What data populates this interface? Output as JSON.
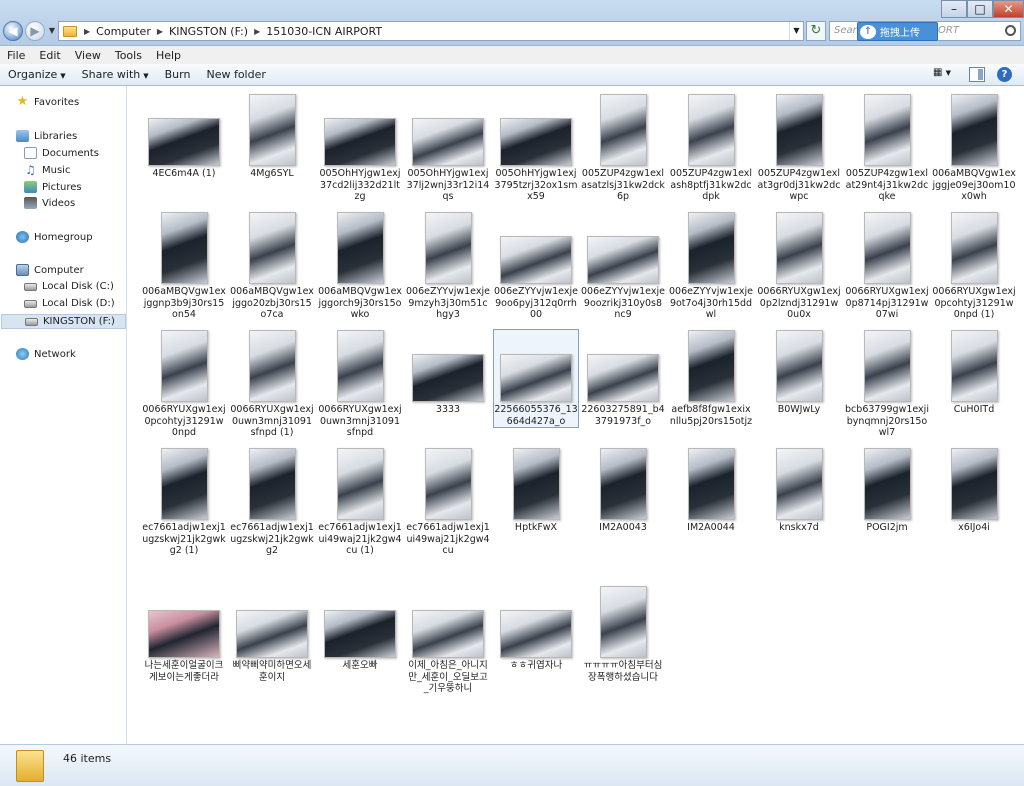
{
  "address": {
    "crumbs": [
      "Computer",
      "KINGSTON (F:)",
      "151030-ICN AIRPORT"
    ],
    "search_placeholder": "Search",
    "search_tail": "ORT"
  },
  "upload_popup": {
    "label": "拖拽上传"
  },
  "menu": [
    "File",
    "Edit",
    "View",
    "Tools",
    "Help"
  ],
  "toolbar": {
    "organize": "Organize",
    "share": "Share with",
    "burn": "Burn",
    "new_folder": "New folder"
  },
  "nav": {
    "favorites": "Favorites",
    "libraries": "Libraries",
    "documents": "Documents",
    "music": "Music",
    "pictures": "Pictures",
    "videos": "Videos",
    "homegroup": "Homegroup",
    "computer": "Computer",
    "local_c": "Local Disk (C:)",
    "local_d": "Local Disk (D:)",
    "kingston": "KINGSTON (F:)",
    "network": "Network"
  },
  "files": [
    {
      "name": "4EC6m4A (1)",
      "shape": "land",
      "tone": "dark"
    },
    {
      "name": "4Mg6SYL",
      "shape": "portrait",
      "tone": "light"
    },
    {
      "name": "005OhHYjgw1exj37cd2lij332d21ltzg",
      "shape": "land",
      "tone": "dark"
    },
    {
      "name": "005OhHYjgw1exj37lj2wnj33r12i14qs",
      "shape": "land",
      "tone": "light"
    },
    {
      "name": "005OhHYjgw1exj3795tzrj32ox1smx59",
      "shape": "land",
      "tone": "dark"
    },
    {
      "name": "005ZUP4zgw1exlasatzlsj31kw2dck6p",
      "shape": "portrait",
      "tone": "light"
    },
    {
      "name": "005ZUP4zgw1exlash8ptfj31kw2dcdpk",
      "shape": "portrait",
      "tone": "light"
    },
    {
      "name": "005ZUP4zgw1exlat3gr0dj31kw2dcwpc",
      "shape": "portrait",
      "tone": "dark"
    },
    {
      "name": "005ZUP4zgw1exlat29nt4j31kw2dcqke",
      "shape": "portrait",
      "tone": "light"
    },
    {
      "name": "006aMBQVgw1exjggje09ej30om10x0wh",
      "shape": "portrait",
      "tone": "dark"
    },
    {
      "name": "006aMBQVgw1exjggnp3b9j30rs15on54",
      "shape": "portrait",
      "tone": "dark"
    },
    {
      "name": "006aMBQVgw1exjggo20zbj30rs15o7ca",
      "shape": "portrait",
      "tone": "light"
    },
    {
      "name": "006aMBQVgw1exjggorch9j30rs15owko",
      "shape": "portrait",
      "tone": "dark"
    },
    {
      "name": "006eZYYvjw1exje9mzyh3j30m51chgy3",
      "shape": "portrait",
      "tone": "light"
    },
    {
      "name": "006eZYYvjw1exje9oo6pyj312q0rrh00",
      "shape": "land",
      "tone": "light"
    },
    {
      "name": "006eZYYvjw1exje9oozrikj310y0s8nc9",
      "shape": "land",
      "tone": "light"
    },
    {
      "name": "006eZYYvjw1exje9ot7o4j30rh15ddwl",
      "shape": "portrait",
      "tone": "dark"
    },
    {
      "name": "0066RYUXgw1exj0p2lzndj31291w0u0x",
      "shape": "portrait",
      "tone": "light"
    },
    {
      "name": "0066RYUXgw1exj0p8714pj31291w07wi",
      "shape": "portrait",
      "tone": "light"
    },
    {
      "name": "0066RYUXgw1exj0pcohtyj31291w0npd (1)",
      "shape": "portrait",
      "tone": "light"
    },
    {
      "name": "0066RYUXgw1exj0pcohtyj31291w0npd",
      "shape": "portrait",
      "tone": "light"
    },
    {
      "name": "0066RYUXgw1exj0uwn3mnj31091sfnpd (1)",
      "shape": "portrait",
      "tone": "light"
    },
    {
      "name": "0066RYUXgw1exj0uwn3mnj31091sfnpd",
      "shape": "portrait",
      "tone": "light"
    },
    {
      "name": "3333",
      "shape": "land",
      "tone": "dark"
    },
    {
      "name": "22566055376_13664d427a_o",
      "shape": "land",
      "tone": "light"
    },
    {
      "name": "22603275891_b43791973f_o",
      "shape": "land",
      "tone": "light"
    },
    {
      "name": "aefb8f8fgw1exixnllu5pj20rs15otjz",
      "shape": "portrait",
      "tone": "dark"
    },
    {
      "name": "B0WJwLy",
      "shape": "portrait",
      "tone": "light"
    },
    {
      "name": "bcb63799gw1exjibynqmnj20rs15owl7",
      "shape": "portrait",
      "tone": "light"
    },
    {
      "name": "CuH0ITd",
      "shape": "portrait",
      "tone": "light"
    },
    {
      "name": "ec7661adjw1exj1ugzskwj21jk2gwkg2 (1)",
      "shape": "portrait",
      "tone": "dark"
    },
    {
      "name": "ec7661adjw1exj1ugzskwj21jk2gwkg2",
      "shape": "portrait",
      "tone": "dark"
    },
    {
      "name": "ec7661adjw1exj1ui49waj21jk2gw4cu (1)",
      "shape": "portrait",
      "tone": "light"
    },
    {
      "name": "ec7661adjw1exj1ui49waj21jk2gw4cu",
      "shape": "portrait",
      "tone": "light"
    },
    {
      "name": "HptkFwX",
      "shape": "portrait",
      "tone": "dark"
    },
    {
      "name": "IM2A0043",
      "shape": "portrait",
      "tone": "dark"
    },
    {
      "name": "IM2A0044",
      "shape": "portrait",
      "tone": "dark"
    },
    {
      "name": "knskx7d",
      "shape": "portrait",
      "tone": "light"
    },
    {
      "name": "POGI2jm",
      "shape": "portrait",
      "tone": "dark"
    },
    {
      "name": "x6IJo4i",
      "shape": "portrait",
      "tone": "dark"
    },
    {
      "name": "나는세훈이얼굴이크게보이는게좋더라",
      "shape": "land",
      "tone": "pink"
    },
    {
      "name": "삐약삐약미하면오세훈이지",
      "shape": "land",
      "tone": "light"
    },
    {
      "name": "세훈오빠",
      "shape": "land",
      "tone": "dark"
    },
    {
      "name": "이제_아침은_아니지만_세훈이_오딜보고_기우뚱하니",
      "shape": "land",
      "tone": "light"
    },
    {
      "name": "ㅎㅎ귀엽자나",
      "shape": "land",
      "tone": "light"
    },
    {
      "name": "ㅠㅠㅠㅠ아침부터심장폭행하셨습니다",
      "shape": "portrait",
      "tone": "light"
    }
  ],
  "status": {
    "count": "46 items"
  }
}
